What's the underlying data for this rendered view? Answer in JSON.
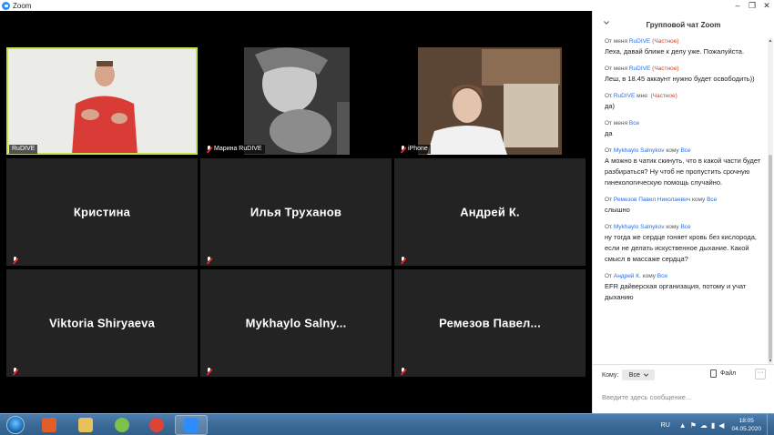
{
  "window": {
    "title": "Zoom",
    "buttons": {
      "minimize": "–",
      "restore": "❐",
      "close": "✕"
    }
  },
  "participants": [
    {
      "display": "",
      "label": "RuDIVE",
      "muted": false,
      "active": true,
      "icon": "person-video"
    },
    {
      "display": "",
      "label": "Марина RuDIVE",
      "muted": true,
      "active": false,
      "icon": "person-video"
    },
    {
      "display": "",
      "label": "iPhone",
      "muted": true,
      "active": false,
      "icon": "person-video"
    },
    {
      "display": "Кристина",
      "label": "",
      "muted": true
    },
    {
      "display": "Илья  Труханов",
      "label": "",
      "muted": true
    },
    {
      "display": "Андрей К.",
      "label": "",
      "muted": true
    },
    {
      "display": "Viktoria Shiryaeva",
      "label": "",
      "muted": true
    },
    {
      "display": "Mykhaylo  Salny...",
      "label": "",
      "muted": true
    },
    {
      "display": "Ремезов  Павел...",
      "label": "",
      "muted": true
    }
  ],
  "chat": {
    "title": "Групповой чат Zoom",
    "messages": [
      {
        "prefix": "От меня",
        "who": "RuDIVE",
        "mid": "",
        "target": "",
        "private": "(Частное)",
        "text": "Леха, давай ближе к делу уже. Пожалуйста."
      },
      {
        "prefix": "От меня",
        "who": "RuDIVE",
        "mid": "",
        "target": "",
        "private": "(Частное)",
        "text": "Леш, в 18.45 аккаунт нужно будет освободить))"
      },
      {
        "prefix": "От",
        "who": "RuDIVE",
        "mid": "мне:",
        "target": "",
        "private": "(Частное)",
        "text": "да)"
      },
      {
        "prefix": "От меня",
        "who": "Все",
        "mid": "",
        "target": "",
        "private": "",
        "text": "да"
      },
      {
        "prefix": "От",
        "who": "Mykhaylo Salnykov",
        "mid": "кому",
        "target": "Все",
        "private": "",
        "text": "А можно в чатик скинуть, что в какой части будет разбираться? Ну чтоб не пропустить срочную гинекологическую помощь случайно."
      },
      {
        "prefix": "От",
        "who": "Ремезов Павел Николаевич",
        "mid": "кому",
        "target": "Все",
        "private": "",
        "text": "слышно"
      },
      {
        "prefix": "От",
        "who": "Mykhaylo Salnykov",
        "mid": "кому",
        "target": "Все",
        "private": "",
        "text": "ну тогда же сердце гоняет кровь без кислорода, если не делать искуственное дыхание. Какой смысл в массаже сердца?"
      },
      {
        "prefix": "От",
        "who": "Андрей К.",
        "mid": "кому",
        "target": "Все",
        "private": "",
        "text": "EFR дайверская организация, потому и учат дыханию"
      }
    ],
    "compose": {
      "to_label": "Кому:",
      "to_value": "Все",
      "file_label": "Файл",
      "more_label": "···",
      "placeholder": "Введите здесь сообщение..."
    }
  },
  "taskbar": {
    "apps": [
      {
        "name": "media-player-icon",
        "color": "#e35d2a"
      },
      {
        "name": "file-explorer-icon",
        "color": "#e9c15a"
      },
      {
        "name": "picasa-icon",
        "color": "#7cc24a"
      },
      {
        "name": "chrome-icon",
        "color": "#db4437"
      },
      {
        "name": "zoom-icon",
        "color": "#2d8cff"
      }
    ],
    "tray": {
      "lang": "RU",
      "time": "18:05",
      "date": "04.05.2020"
    }
  }
}
